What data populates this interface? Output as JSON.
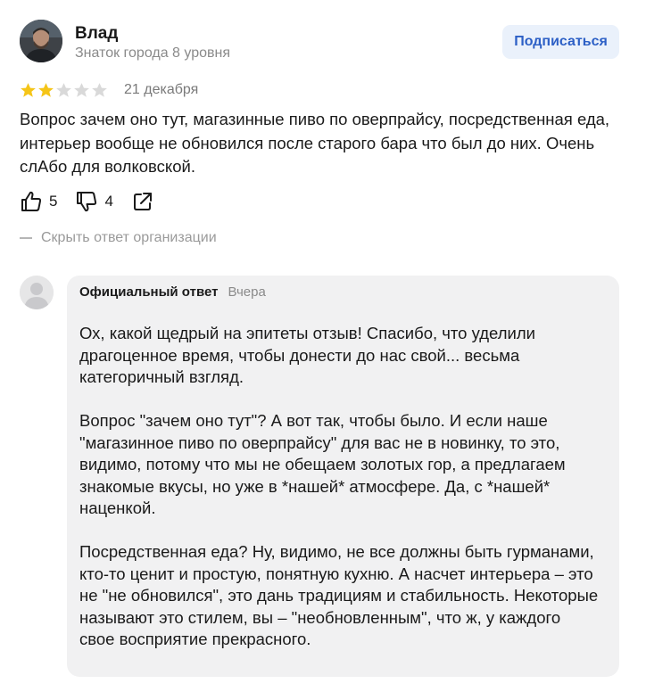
{
  "author": {
    "name": "Влад",
    "level": "Знаток города 8 уровня",
    "avatar_icon": "user-photo"
  },
  "subscribe": {
    "label": "Подписаться"
  },
  "review": {
    "rating": 2,
    "max_rating": 5,
    "date": "21 декабря",
    "text": "Вопрос зачем оно тут, магазинные пиво по оверпрайсу, посредственная еда, интерьер вообще не обновился после старого бара что был до них. Очень слАбо для волковской."
  },
  "actions": {
    "likes": "5",
    "dislikes": "4",
    "like_icon": "thumbs-up-icon",
    "dislike_icon": "thumbs-down-icon",
    "share_icon": "share-icon"
  },
  "hide_reply": {
    "label": "Скрыть ответ организации"
  },
  "reply": {
    "title": "Официальный ответ",
    "when": "Вчера",
    "paragraphs": [
      "Ох, какой щедрый на эпитеты отзыв! Спасибо, что уделили драгоценное время, чтобы донести до нас свой... весьма категоричный взгляд.",
      "Вопрос \"зачем оно тут\"? А вот так, чтобы было. И если наше \"магазинное пиво по оверпрайсу\" для вас не в новинку, то это, видимо, потому что мы не обещаем золотых гор, а предлагаем знакомые вкусы, но уже в *нашей* атмосфере. Да, с *нашей* наценкой.",
      "Посредственная еда? Ну, видимо, не все должны быть гурманами, кто-то ценит и простую, понятную кухню. А насчет интерьера – это не \"не обновился\", это дань традициям и стабильность. Некоторые называют это стилем, вы – \"необновленным\", что ж, у каждого свое восприятие прекрасного."
    ]
  },
  "colors": {
    "star_filled": "#f5c518",
    "star_empty": "#d9d9d9",
    "accent": "#2d60c6",
    "button_bg": "#eaf1fb",
    "card_bg": "#f1f1f2"
  }
}
